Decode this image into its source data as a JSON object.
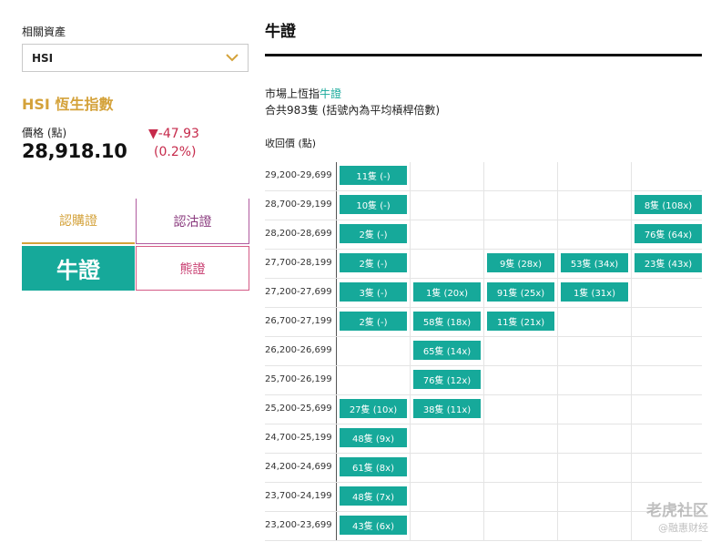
{
  "left": {
    "asset_label": "相關資產",
    "select_value": "HSI",
    "index_name": "HSI 恆生指數",
    "price_label": "價格 (點)",
    "price": "28,918.10",
    "change": "▼-47.93",
    "change_pct": "(0.2%)",
    "tabs": {
      "call": "認購證",
      "put": "認沽證",
      "bull": "牛證",
      "bear": "熊證"
    }
  },
  "right": {
    "title": "牛證",
    "sub_prefix": "市場上恆指",
    "sub_highlight": "牛證",
    "sub2": "合共983隻 (括號內為平均槓桿倍數)",
    "col_head": "收回價 (點)",
    "rows": [
      {
        "range": "29,200-29,699",
        "cells": [
          "11隻 (-)",
          "",
          "",
          "",
          ""
        ]
      },
      {
        "range": "28,700-29,199",
        "cells": [
          "10隻 (-)",
          "",
          "",
          "",
          "8隻 (108x)"
        ]
      },
      {
        "range": "28,200-28,699",
        "cells": [
          "2隻 (-)",
          "",
          "",
          "",
          "76隻 (64x)"
        ]
      },
      {
        "range": "27,700-28,199",
        "cells": [
          "2隻 (-)",
          "",
          "9隻 (28x)",
          "53隻 (34x)",
          "23隻 (43x)"
        ]
      },
      {
        "range": "27,200-27,699",
        "cells": [
          "3隻 (-)",
          "1隻 (20x)",
          "91隻 (25x)",
          "1隻 (31x)",
          ""
        ]
      },
      {
        "range": "26,700-27,199",
        "cells": [
          "2隻 (-)",
          "58隻 (18x)",
          "11隻 (21x)",
          "",
          ""
        ]
      },
      {
        "range": "26,200-26,699",
        "cells": [
          "",
          "65隻 (14x)",
          "",
          "",
          ""
        ]
      },
      {
        "range": "25,700-26,199",
        "cells": [
          "",
          "76隻 (12x)",
          "",
          "",
          ""
        ]
      },
      {
        "range": "25,200-25,699",
        "cells": [
          "27隻 (10x)",
          "38隻 (11x)",
          "",
          "",
          ""
        ]
      },
      {
        "range": "24,700-25,199",
        "cells": [
          "48隻 (9x)",
          "",
          "",
          "",
          ""
        ]
      },
      {
        "range": "24,200-24,699",
        "cells": [
          "61隻 (8x)",
          "",
          "",
          "",
          ""
        ]
      },
      {
        "range": "23,700-24,199",
        "cells": [
          "48隻 (7x)",
          "",
          "",
          "",
          ""
        ]
      },
      {
        "range": "23,200-23,699",
        "cells": [
          "43隻 (6x)",
          "",
          "",
          "",
          ""
        ]
      }
    ]
  },
  "watermark": {
    "line1": "老虎社区",
    "line2": "@融惠财经"
  },
  "colors": {
    "teal": "#16a99a",
    "gold": "#d4a23a",
    "red": "#c62a4b"
  }
}
